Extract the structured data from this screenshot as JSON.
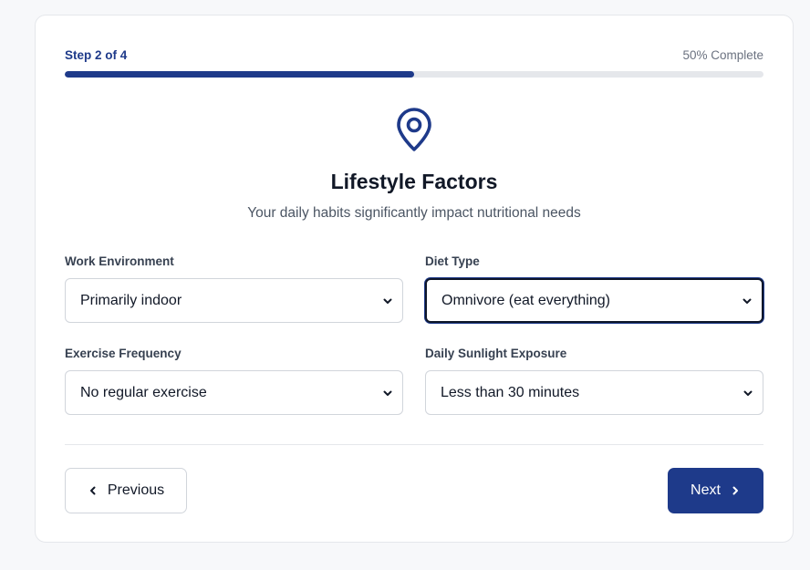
{
  "progress": {
    "step_label": "Step 2 of 4",
    "percent_label": "50% Complete",
    "fraction": 0.5
  },
  "header": {
    "icon": "map-pin-icon",
    "title": "Lifestyle Factors",
    "subtitle": "Your daily habits significantly impact nutritional needs"
  },
  "fields": {
    "work_environment": {
      "label": "Work Environment",
      "value": "Primarily indoor"
    },
    "diet_type": {
      "label": "Diet Type",
      "value": "Omnivore (eat everything)"
    },
    "exercise_frequency": {
      "label": "Exercise Frequency",
      "value": "No regular exercise"
    },
    "sunlight_exposure": {
      "label": "Daily Sunlight Exposure",
      "value": "Less than 30 minutes"
    }
  },
  "buttons": {
    "previous_label": "Previous",
    "next_label": "Next"
  },
  "colors": {
    "accent": "#1e3a8a",
    "track": "#e5e7eb"
  }
}
